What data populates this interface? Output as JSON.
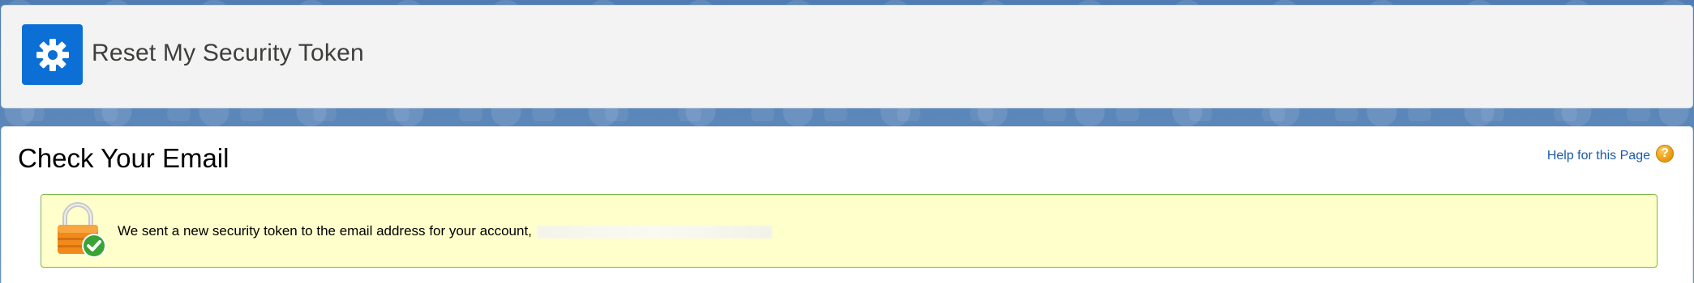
{
  "header": {
    "title": "Reset My Security Token",
    "icon": "gear-icon",
    "icon_bg": "#0b6fd6"
  },
  "page": {
    "title": "Check Your Email",
    "help_link": "Help for this Page",
    "help_icon_glyph": "?"
  },
  "message": {
    "text": "We sent a new security token to the email address for your account,",
    "icon": "lock-check-icon",
    "background": "#ffffcc",
    "border": "#7ab648"
  }
}
